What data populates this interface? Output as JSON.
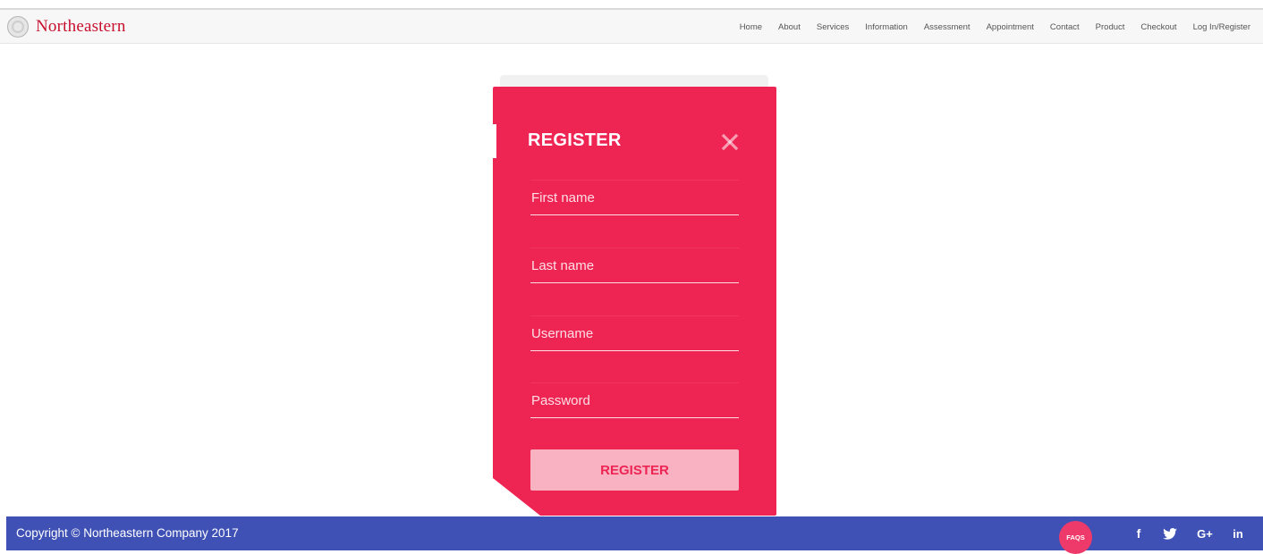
{
  "brand": {
    "name": "Northeastern"
  },
  "nav": {
    "items": [
      "Home",
      "About",
      "Services",
      "Information",
      "Assessment",
      "Appointment",
      "Contact",
      "Product",
      "Checkout",
      "Log In/Register"
    ]
  },
  "register": {
    "title": "REGISTER",
    "fields": {
      "first_name": {
        "placeholder": "First name",
        "value": ""
      },
      "last_name": {
        "placeholder": "Last name",
        "value": ""
      },
      "username": {
        "placeholder": "Username",
        "value": ""
      },
      "password": {
        "placeholder": "Password",
        "value": ""
      }
    },
    "submit_label": "REGISTER"
  },
  "footer": {
    "copyright": "Copyright © Northeastern Company 2017",
    "faqs_label": "FAQS",
    "social": {
      "facebook": "f",
      "google_plus": "G+",
      "linkedin": "in"
    }
  },
  "colors": {
    "accent": "#ee2453",
    "footer": "#3f51b5",
    "brand": "#c8102e"
  },
  "icons": {
    "close": "close-icon",
    "twitter": "twitter-icon",
    "seal": "seal-icon"
  }
}
